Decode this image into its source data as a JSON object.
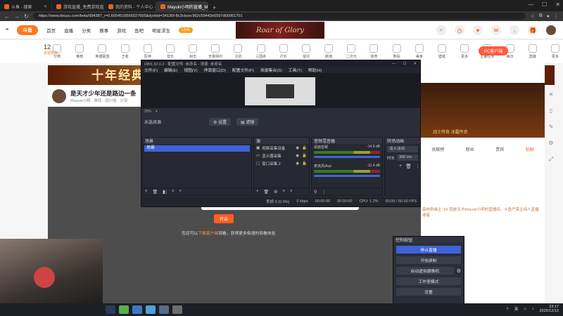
{
  "browser": {
    "tabs": [
      {
        "label": "斗鱼 - 搜索",
        "active": false
      },
      {
        "label": "游戏直播_免费游戏直播_斗鱼直播",
        "active": false
      },
      {
        "label": "我的资料 - 个人中心 - 斗鱼",
        "active": false
      },
      {
        "label": "Mayuki小明的直播_Mayuki小明",
        "active": true
      }
    ],
    "new_tab": "+",
    "url": "https://www.douyu.com/beta/994387_r=0.6654516566027655&dyshid=34136f-8c3cbcec962c59443e5597d00061701"
  },
  "site": {
    "logo": "斗鱼",
    "nav": [
      "首页",
      "直播",
      "分类",
      "赛事",
      "游戏",
      "鱼吧",
      "明星求生"
    ],
    "live_badge": "LIVE",
    "banner": "Roar of Glory",
    "level": {
      "value": "12",
      "label": "去领奖励"
    },
    "categories": [
      "分类",
      "推荐",
      "英雄联盟",
      "王者",
      "原神",
      "音乐",
      "射击",
      "无畏契约",
      "主机",
      "三国杀",
      "户外",
      "蛋仔",
      "颜值",
      "二次元",
      "体育",
      "数码",
      "美食",
      "壁纸",
      "更多",
      "主播任务",
      "每日",
      "直播",
      "更多"
    ],
    "pc_promo": "PC客户端",
    "ad_title": "十年经典",
    "stream": {
      "title": "是天才少年还是路边一条",
      "meta": "Mayuki小明 · 游戏 · 四川省 · 分享"
    },
    "prompt": {
      "button": "开启",
      "line_prefix": "您还可以",
      "line_link": "下载客户端",
      "line_suffix": "观看，获得更多极速的观看体验"
    },
    "right": {
      "game_text": "战士传奇  冰霜传奇",
      "tabs": [
        "贡献榜",
        "粉丝",
        "贵宾",
        "钻粉"
      ],
      "chat": "森林奇缘主: 66  我是天才Mayuki小明的直播间，斗鱼严禁主持人直播或者..."
    }
  },
  "obs": {
    "title": "OBS 32.0.2 - 配置文件: 未命名 - 场景: 未命名",
    "menu": [
      "文件(F)",
      "编辑(E)",
      "视图(V)",
      "停靠窗口(D)",
      "配置文件(P)",
      "场景集合(S)",
      "工具(T)",
      "帮助(H)"
    ],
    "zoom": "25%",
    "no_source": "未选择源",
    "source_bar": [
      "设置",
      "滤镜"
    ],
    "docks": {
      "scenes": "场景",
      "sources": "源",
      "mixer": "音频混音器",
      "transitions": "转场动画"
    },
    "scenes": [
      "场景"
    ],
    "sources": [
      "视频采集设备",
      "显示器采集",
      "窗口采集 2"
    ],
    "mixer": [
      {
        "name": "桌面音频",
        "db": "-14.9 dB"
      },
      {
        "name": "麦克风/Aux",
        "db": "-11.4 dB"
      }
    ],
    "transition": {
      "type": "淡入淡出",
      "duration_label": "时长",
      "duration": "300 ms"
    },
    "status": {
      "dropped": "丢帧 0 (0.0%)",
      "bitrate": "0 kbps",
      "time1": "00:00:00",
      "time2": "00:00:00",
      "cpu": "CPU: 1.2%",
      "fps": "60.00 / 60.00 FPS"
    }
  },
  "controls": {
    "title": "控制按钮",
    "buttons": [
      "停止直播",
      "开始录制",
      "启动虚拟摄像机",
      "工作室模式",
      "设置"
    ]
  },
  "taskbar": {
    "lang": "英",
    "time": "23:17",
    "date": "2025/12/13"
  }
}
